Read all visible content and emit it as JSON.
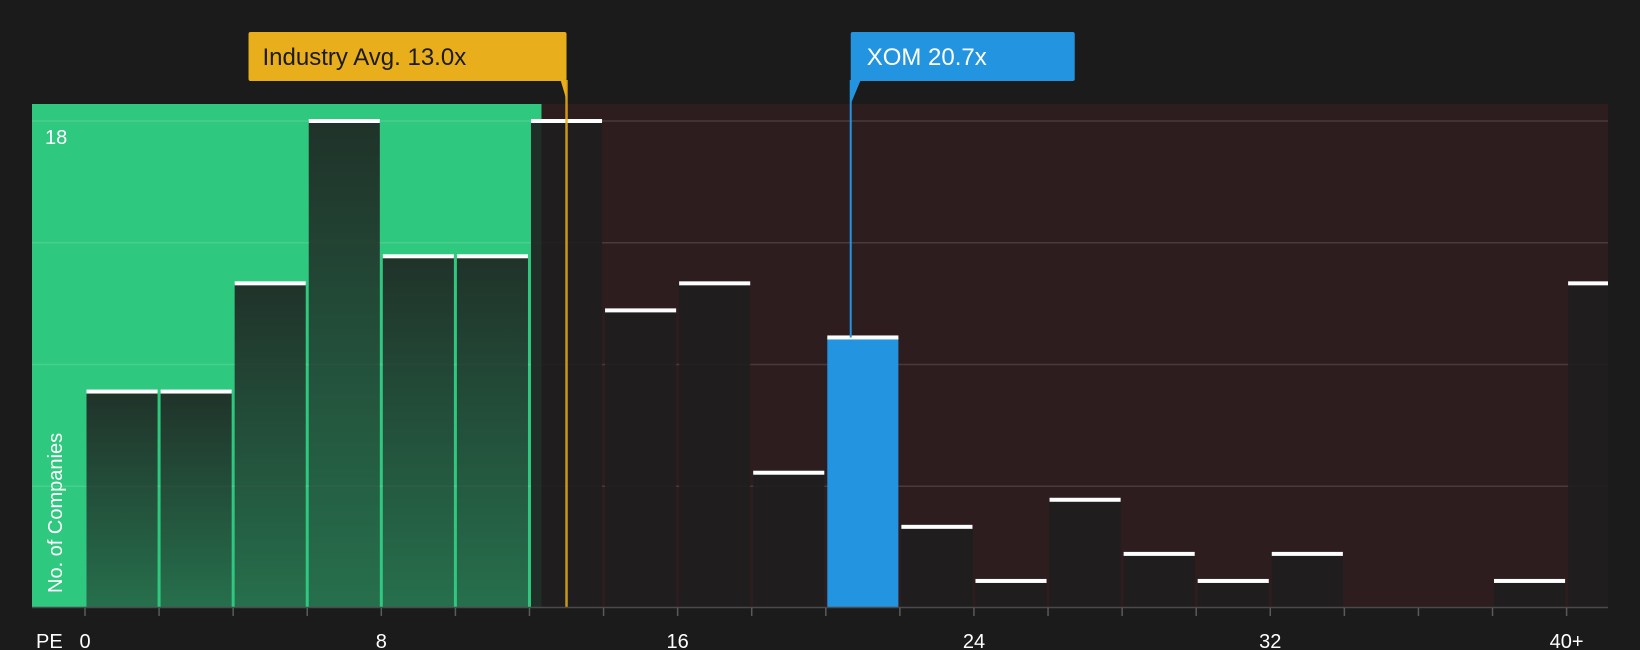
{
  "chart_data": {
    "type": "bar",
    "x_axis_label": "PE",
    "y_axis_label": "No. of Companies",
    "y_top_label": "18",
    "ylim": [
      0,
      18
    ],
    "x_tick_labels": [
      {
        "value": 0,
        "label": "0"
      },
      {
        "value": 8,
        "label": "8"
      },
      {
        "value": 16,
        "label": "16"
      },
      {
        "value": 24,
        "label": "24"
      },
      {
        "value": 32,
        "label": "32"
      },
      {
        "value": 40,
        "label": "40+"
      }
    ],
    "bin_width": 2,
    "bins": [
      {
        "start": 0,
        "count": 8
      },
      {
        "start": 2,
        "count": 8
      },
      {
        "start": 4,
        "count": 12
      },
      {
        "start": 6,
        "count": 18
      },
      {
        "start": 8,
        "count": 13
      },
      {
        "start": 10,
        "count": 13
      },
      {
        "start": 12,
        "count": 18
      },
      {
        "start": 14,
        "count": 11
      },
      {
        "start": 16,
        "count": 12
      },
      {
        "start": 18,
        "count": 5
      },
      {
        "start": 20,
        "count": 10
      },
      {
        "start": 22,
        "count": 3
      },
      {
        "start": 24,
        "count": 1
      },
      {
        "start": 26,
        "count": 4
      },
      {
        "start": 28,
        "count": 2
      },
      {
        "start": 30,
        "count": 1
      },
      {
        "start": 32,
        "count": 2
      },
      {
        "start": 34,
        "count": 0
      },
      {
        "start": 36,
        "count": 0
      },
      {
        "start": 38,
        "count": 1
      },
      {
        "start": 40,
        "count": 12
      }
    ],
    "industry_avg": {
      "value": 13.0,
      "label": "Industry Avg. 13.0x"
    },
    "company": {
      "value": 20.7,
      "label": "XOM 20.7x"
    },
    "colors": {
      "background": "#1b1b1b",
      "undervalued_zone": "#2fc87f",
      "overvalued_zone": "#2e1d1e",
      "bar_dark": "#1e1e1e",
      "industry_marker": "#e8ae1b",
      "company_marker": "#2394e0",
      "bar_cap": "#ffffff"
    }
  }
}
